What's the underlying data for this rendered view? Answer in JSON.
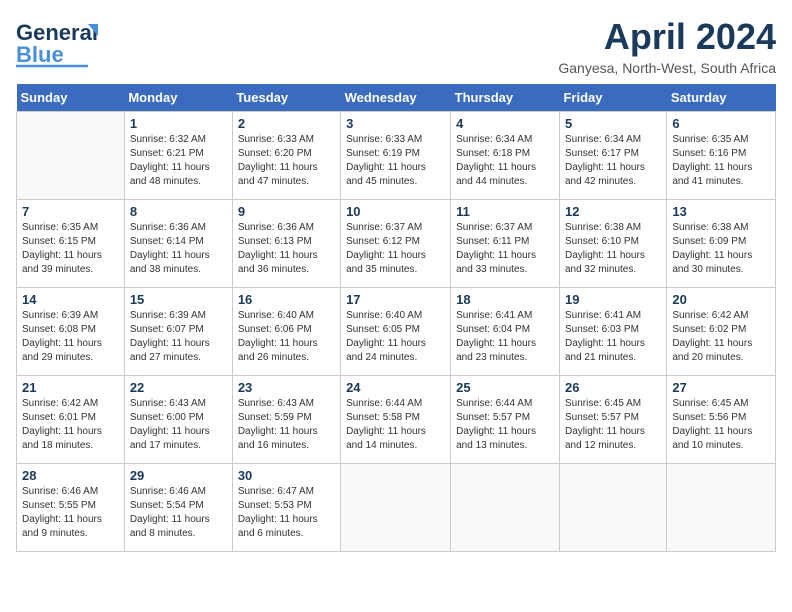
{
  "header": {
    "logo_general": "General",
    "logo_blue": "Blue",
    "month": "April 2024",
    "location": "Ganyesa, North-West, South Africa"
  },
  "weekdays": [
    "Sunday",
    "Monday",
    "Tuesday",
    "Wednesday",
    "Thursday",
    "Friday",
    "Saturday"
  ],
  "weeks": [
    [
      {
        "day": "",
        "sunrise": "",
        "sunset": "",
        "daylight": ""
      },
      {
        "day": "1",
        "sunrise": "Sunrise: 6:32 AM",
        "sunset": "Sunset: 6:21 PM",
        "daylight": "Daylight: 11 hours and 48 minutes."
      },
      {
        "day": "2",
        "sunrise": "Sunrise: 6:33 AM",
        "sunset": "Sunset: 6:20 PM",
        "daylight": "Daylight: 11 hours and 47 minutes."
      },
      {
        "day": "3",
        "sunrise": "Sunrise: 6:33 AM",
        "sunset": "Sunset: 6:19 PM",
        "daylight": "Daylight: 11 hours and 45 minutes."
      },
      {
        "day": "4",
        "sunrise": "Sunrise: 6:34 AM",
        "sunset": "Sunset: 6:18 PM",
        "daylight": "Daylight: 11 hours and 44 minutes."
      },
      {
        "day": "5",
        "sunrise": "Sunrise: 6:34 AM",
        "sunset": "Sunset: 6:17 PM",
        "daylight": "Daylight: 11 hours and 42 minutes."
      },
      {
        "day": "6",
        "sunrise": "Sunrise: 6:35 AM",
        "sunset": "Sunset: 6:16 PM",
        "daylight": "Daylight: 11 hours and 41 minutes."
      }
    ],
    [
      {
        "day": "7",
        "sunrise": "Sunrise: 6:35 AM",
        "sunset": "Sunset: 6:15 PM",
        "daylight": "Daylight: 11 hours and 39 minutes."
      },
      {
        "day": "8",
        "sunrise": "Sunrise: 6:36 AM",
        "sunset": "Sunset: 6:14 PM",
        "daylight": "Daylight: 11 hours and 38 minutes."
      },
      {
        "day": "9",
        "sunrise": "Sunrise: 6:36 AM",
        "sunset": "Sunset: 6:13 PM",
        "daylight": "Daylight: 11 hours and 36 minutes."
      },
      {
        "day": "10",
        "sunrise": "Sunrise: 6:37 AM",
        "sunset": "Sunset: 6:12 PM",
        "daylight": "Daylight: 11 hours and 35 minutes."
      },
      {
        "day": "11",
        "sunrise": "Sunrise: 6:37 AM",
        "sunset": "Sunset: 6:11 PM",
        "daylight": "Daylight: 11 hours and 33 minutes."
      },
      {
        "day": "12",
        "sunrise": "Sunrise: 6:38 AM",
        "sunset": "Sunset: 6:10 PM",
        "daylight": "Daylight: 11 hours and 32 minutes."
      },
      {
        "day": "13",
        "sunrise": "Sunrise: 6:38 AM",
        "sunset": "Sunset: 6:09 PM",
        "daylight": "Daylight: 11 hours and 30 minutes."
      }
    ],
    [
      {
        "day": "14",
        "sunrise": "Sunrise: 6:39 AM",
        "sunset": "Sunset: 6:08 PM",
        "daylight": "Daylight: 11 hours and 29 minutes."
      },
      {
        "day": "15",
        "sunrise": "Sunrise: 6:39 AM",
        "sunset": "Sunset: 6:07 PM",
        "daylight": "Daylight: 11 hours and 27 minutes."
      },
      {
        "day": "16",
        "sunrise": "Sunrise: 6:40 AM",
        "sunset": "Sunset: 6:06 PM",
        "daylight": "Daylight: 11 hours and 26 minutes."
      },
      {
        "day": "17",
        "sunrise": "Sunrise: 6:40 AM",
        "sunset": "Sunset: 6:05 PM",
        "daylight": "Daylight: 11 hours and 24 minutes."
      },
      {
        "day": "18",
        "sunrise": "Sunrise: 6:41 AM",
        "sunset": "Sunset: 6:04 PM",
        "daylight": "Daylight: 11 hours and 23 minutes."
      },
      {
        "day": "19",
        "sunrise": "Sunrise: 6:41 AM",
        "sunset": "Sunset: 6:03 PM",
        "daylight": "Daylight: 11 hours and 21 minutes."
      },
      {
        "day": "20",
        "sunrise": "Sunrise: 6:42 AM",
        "sunset": "Sunset: 6:02 PM",
        "daylight": "Daylight: 11 hours and 20 minutes."
      }
    ],
    [
      {
        "day": "21",
        "sunrise": "Sunrise: 6:42 AM",
        "sunset": "Sunset: 6:01 PM",
        "daylight": "Daylight: 11 hours and 18 minutes."
      },
      {
        "day": "22",
        "sunrise": "Sunrise: 6:43 AM",
        "sunset": "Sunset: 6:00 PM",
        "daylight": "Daylight: 11 hours and 17 minutes."
      },
      {
        "day": "23",
        "sunrise": "Sunrise: 6:43 AM",
        "sunset": "Sunset: 5:59 PM",
        "daylight": "Daylight: 11 hours and 16 minutes."
      },
      {
        "day": "24",
        "sunrise": "Sunrise: 6:44 AM",
        "sunset": "Sunset: 5:58 PM",
        "daylight": "Daylight: 11 hours and 14 minutes."
      },
      {
        "day": "25",
        "sunrise": "Sunrise: 6:44 AM",
        "sunset": "Sunset: 5:57 PM",
        "daylight": "Daylight: 11 hours and 13 minutes."
      },
      {
        "day": "26",
        "sunrise": "Sunrise: 6:45 AM",
        "sunset": "Sunset: 5:57 PM",
        "daylight": "Daylight: 11 hours and 12 minutes."
      },
      {
        "day": "27",
        "sunrise": "Sunrise: 6:45 AM",
        "sunset": "Sunset: 5:56 PM",
        "daylight": "Daylight: 11 hours and 10 minutes."
      }
    ],
    [
      {
        "day": "28",
        "sunrise": "Sunrise: 6:46 AM",
        "sunset": "Sunset: 5:55 PM",
        "daylight": "Daylight: 11 hours and 9 minutes."
      },
      {
        "day": "29",
        "sunrise": "Sunrise: 6:46 AM",
        "sunset": "Sunset: 5:54 PM",
        "daylight": "Daylight: 11 hours and 8 minutes."
      },
      {
        "day": "30",
        "sunrise": "Sunrise: 6:47 AM",
        "sunset": "Sunset: 5:53 PM",
        "daylight": "Daylight: 11 hours and 6 minutes."
      },
      {
        "day": "",
        "sunrise": "",
        "sunset": "",
        "daylight": ""
      },
      {
        "day": "",
        "sunrise": "",
        "sunset": "",
        "daylight": ""
      },
      {
        "day": "",
        "sunrise": "",
        "sunset": "",
        "daylight": ""
      },
      {
        "day": "",
        "sunrise": "",
        "sunset": "",
        "daylight": ""
      }
    ]
  ]
}
